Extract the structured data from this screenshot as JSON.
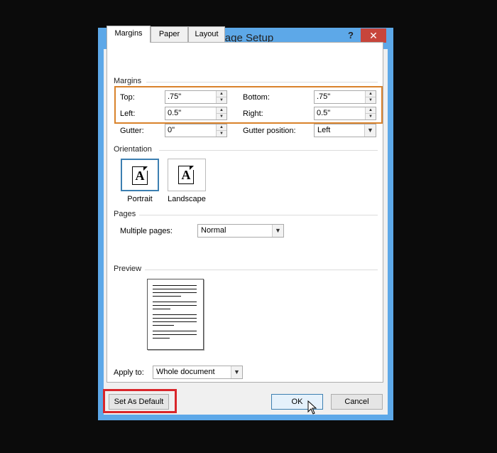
{
  "window": {
    "title": "Page Setup",
    "help": "?",
    "close": "✕"
  },
  "tabs": [
    "Margins",
    "Paper",
    "Layout"
  ],
  "margins": {
    "section": "Margins",
    "top": {
      "label": "Top:",
      "value": ".75\""
    },
    "bottom": {
      "label": "Bottom:",
      "value": ".75\""
    },
    "left": {
      "label": "Left:",
      "value": "0.5\""
    },
    "right": {
      "label": "Right:",
      "value": "0.5\""
    },
    "gutter": {
      "label": "Gutter:",
      "value": "0\""
    },
    "gutter_position": {
      "label": "Gutter position:",
      "value": "Left"
    }
  },
  "orientation": {
    "section": "Orientation",
    "portrait": "Portrait",
    "landscape": "Landscape",
    "glyph": "A"
  },
  "pages": {
    "section": "Pages",
    "multiple_label": "Multiple pages:",
    "multiple_value": "Normal"
  },
  "preview": {
    "section": "Preview"
  },
  "apply": {
    "label": "Apply to:",
    "value": "Whole document"
  },
  "buttons": {
    "set_default": "Set As Default",
    "ok": "OK",
    "cancel": "Cancel"
  },
  "colors": {
    "title_bar": "#5da8e8",
    "close": "#c7453b",
    "highlight_orange": "#d9822b",
    "highlight_red": "#d9262b"
  }
}
